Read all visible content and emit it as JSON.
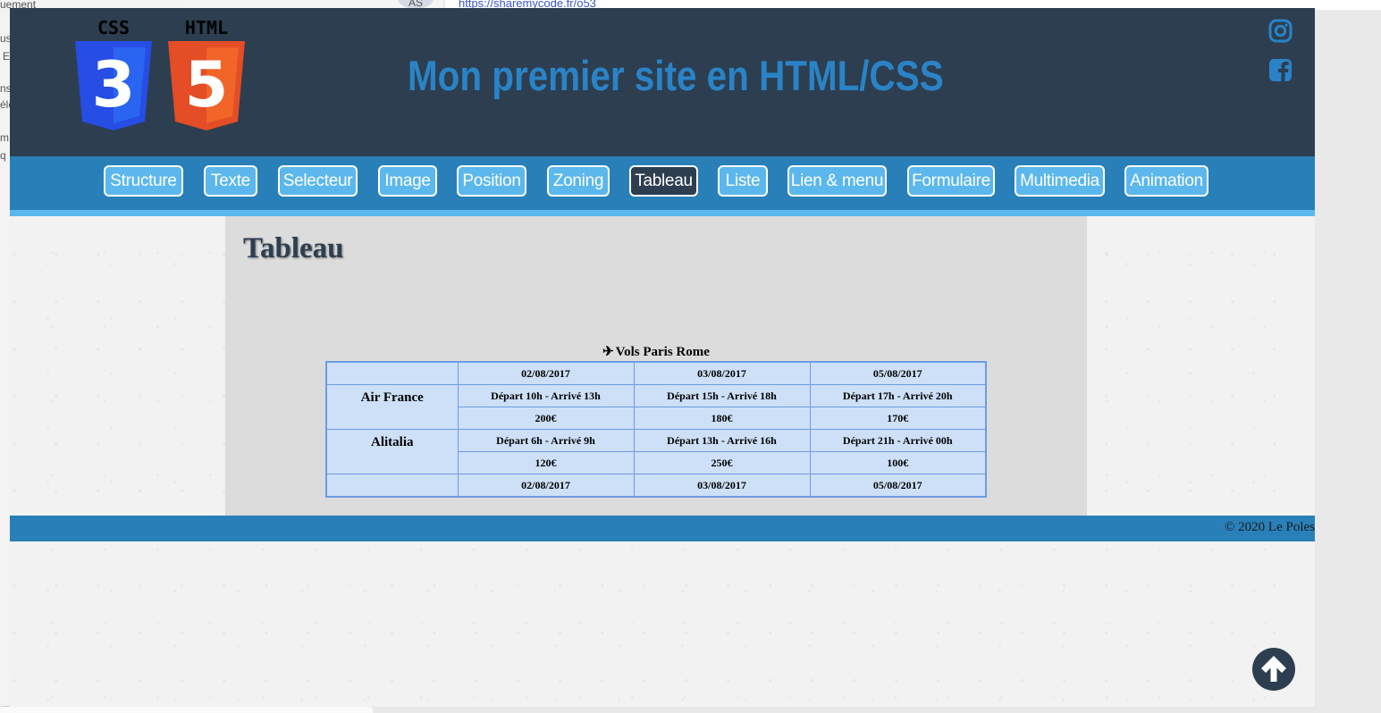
{
  "background": {
    "left_fragments": [
      "uement",
      "us",
      "E",
      "ns",
      "élé",
      "m",
      "q"
    ],
    "avatar_initials": "AS",
    "url_text": "https://sharemycode.fr/o53"
  },
  "header": {
    "css_logo_label": "CSS",
    "css_logo_number": "3",
    "html_logo_label": "HTML",
    "html_logo_number": "5",
    "title": "Mon premier site en HTML/CSS",
    "social": [
      "instagram-icon",
      "facebook-icon"
    ]
  },
  "nav": {
    "items": [
      {
        "label": "Structure"
      },
      {
        "label": "Texte"
      },
      {
        "label": "Selecteur"
      },
      {
        "label": "Image"
      },
      {
        "label": "Position"
      },
      {
        "label": "Zoning"
      },
      {
        "label": "Tableau",
        "active": true
      },
      {
        "label": "Liste"
      },
      {
        "label": "Lien & menu"
      },
      {
        "label": "Formulaire"
      },
      {
        "label": "Multimedia"
      },
      {
        "label": "Animation"
      }
    ]
  },
  "main": {
    "title": "Tableau",
    "table": {
      "caption": "Vols Paris Rome",
      "dates_header": [
        "02/08/2017",
        "03/08/2017",
        "05/08/2017"
      ],
      "airlines": [
        {
          "name": "Air France",
          "times": [
            "Départ 10h - Arrivé 13h",
            "Départ 15h - Arrivé 18h",
            "Départ 17h - Arrivé 20h"
          ],
          "prices": [
            "200€",
            "180€",
            "170€"
          ]
        },
        {
          "name": "Alitalia",
          "times": [
            "Départ 6h - Arrivé 9h",
            "Départ 13h - Arrivé 16h",
            "Départ 21h - Arrivé 00h"
          ],
          "prices": [
            "120€",
            "250€",
            "100€"
          ]
        }
      ],
      "dates_footer": [
        "02/08/2017",
        "03/08/2017",
        "05/08/2017"
      ]
    }
  },
  "footer": {
    "copyright": "© 2020 Le Poles"
  },
  "colors": {
    "header_bg": "#2d3e50",
    "nav_bg": "#2980b9",
    "nav_button": "#5bb7ec",
    "title_blue": "#2a83c6",
    "table_bg": "#cde0f7",
    "table_border": "#6d9be6"
  }
}
